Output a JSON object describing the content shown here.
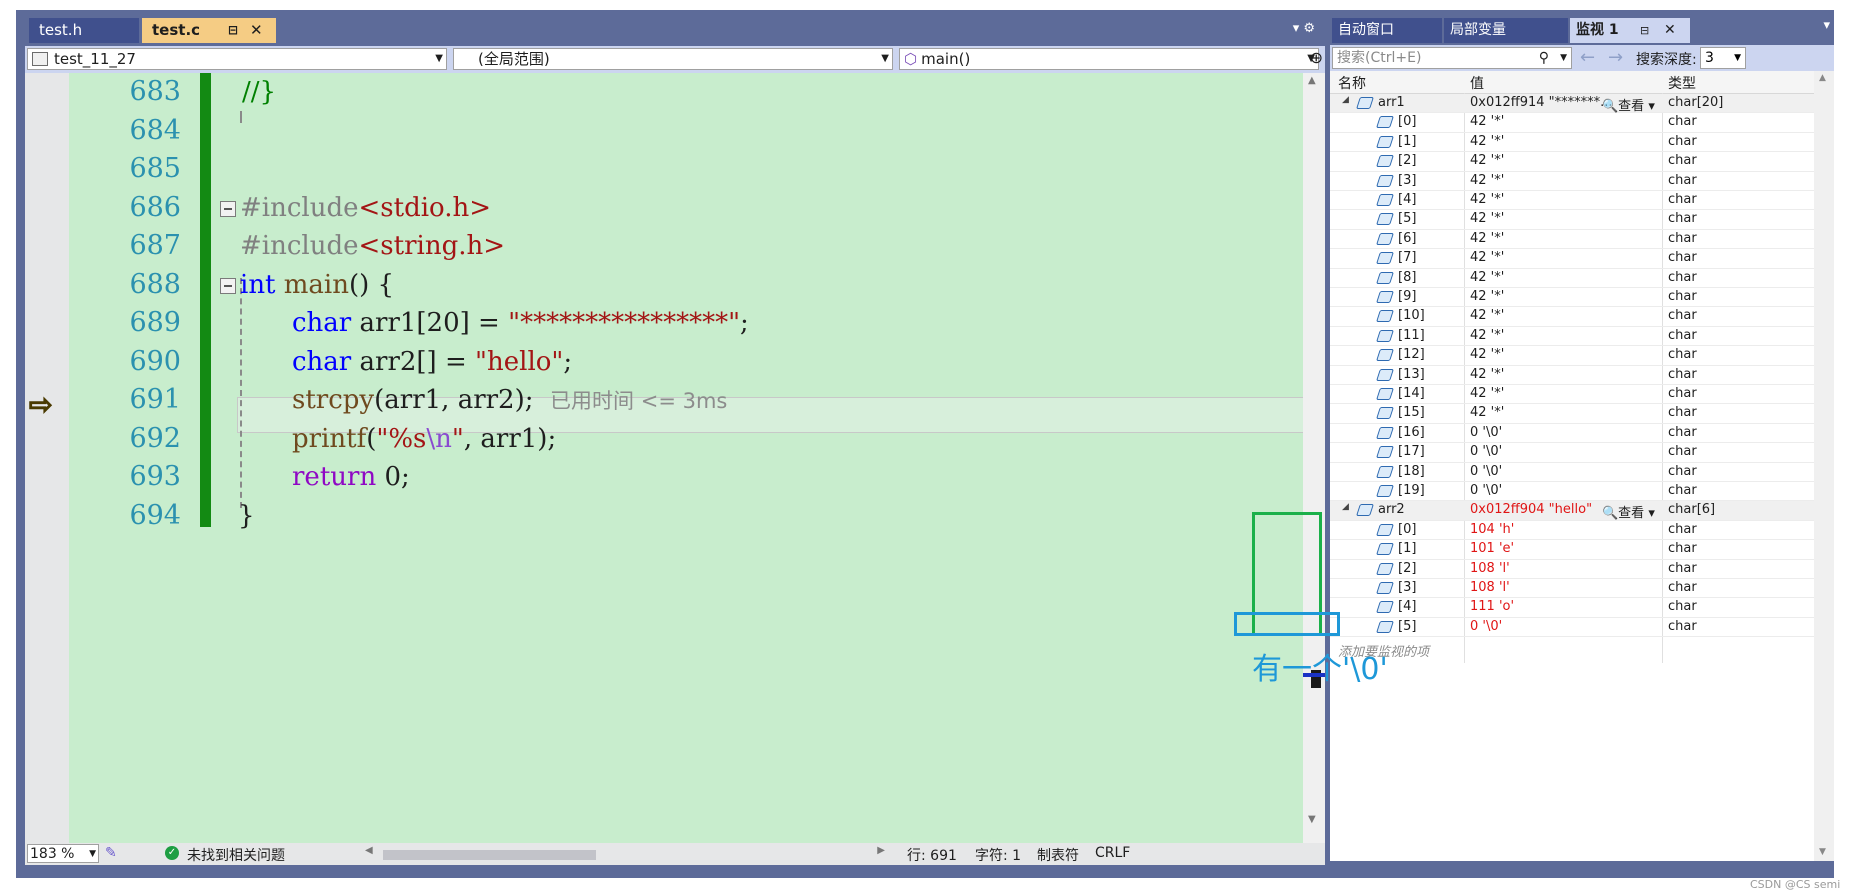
{
  "editor": {
    "tabs": [
      {
        "label": "test.h"
      },
      {
        "label": "test.c",
        "pin": "⊟",
        "close": "✕"
      }
    ],
    "tab_overflow": "▾ ⚙",
    "nav": {
      "project": "test_11_27",
      "scope": "(全局范围)",
      "function": "main()"
    },
    "lines": [
      683,
      684,
      685,
      686,
      687,
      688,
      689,
      690,
      691,
      692,
      693,
      694
    ],
    "code": {
      "l683": "//}",
      "l686_directive": "#include",
      "l686_header": "<stdio.h>",
      "l687_directive": "#include",
      "l687_header": "<string.h>",
      "l688_type": "int",
      "l688_func": "main",
      "l688_rest": "() {",
      "l689_type": "char",
      "l689_var": " arr1[20] = ",
      "l689_str": "\"****************\"",
      "l689_end": ";",
      "l690_type": "char",
      "l690_var": " arr2[] = ",
      "l690_str": "\"hello\"",
      "l690_end": ";",
      "l691_func": "strcpy",
      "l691_rest": "(arr1, arr2);",
      "l691_perf": "已用时间 <= 3ms",
      "l692_func": "printf",
      "l692_open": "(",
      "l692_str_a": "\"%s",
      "l692_esc": "\\n",
      "l692_str_b": "\"",
      "l692_rest": ", arr1);",
      "l693_kw": "return",
      "l693_rest": " 0;",
      "l694": "}"
    }
  },
  "status": {
    "zoom": "183 %",
    "issues": "未找到相关问题",
    "line": "行: 691",
    "char": "字符: 1",
    "tabs": "制表符",
    "eol": "CRLF"
  },
  "watch": {
    "tabs": {
      "auto": "自动窗口",
      "locals": "局部变量",
      "watch": "监视 1",
      "pin": "⊟",
      "close": "✕"
    },
    "overflow": "▾",
    "search_placeholder": "搜索(Ctrl+E)",
    "search_icon": "⚲",
    "back_arrow": "←",
    "forward_arrow": "→",
    "depth_label": "搜索深度:",
    "depth_value": "3",
    "columns": {
      "name": "名称",
      "value": "值",
      "type": "类型"
    },
    "arr1": {
      "name": "arr1",
      "value": "0x012ff914 \"*******...",
      "look": "🔍查看 ▾",
      "type": "char[20]"
    },
    "arr1_items": [
      {
        "name": "[0]",
        "value": "42 '*'",
        "type": "char"
      },
      {
        "name": "[1]",
        "value": "42 '*'",
        "type": "char"
      },
      {
        "name": "[2]",
        "value": "42 '*'",
        "type": "char"
      },
      {
        "name": "[3]",
        "value": "42 '*'",
        "type": "char"
      },
      {
        "name": "[4]",
        "value": "42 '*'",
        "type": "char"
      },
      {
        "name": "[5]",
        "value": "42 '*'",
        "type": "char"
      },
      {
        "name": "[6]",
        "value": "42 '*'",
        "type": "char"
      },
      {
        "name": "[7]",
        "value": "42 '*'",
        "type": "char"
      },
      {
        "name": "[8]",
        "value": "42 '*'",
        "type": "char"
      },
      {
        "name": "[9]",
        "value": "42 '*'",
        "type": "char"
      },
      {
        "name": "[10]",
        "value": "42 '*'",
        "type": "char"
      },
      {
        "name": "[11]",
        "value": "42 '*'",
        "type": "char"
      },
      {
        "name": "[12]",
        "value": "42 '*'",
        "type": "char"
      },
      {
        "name": "[13]",
        "value": "42 '*'",
        "type": "char"
      },
      {
        "name": "[14]",
        "value": "42 '*'",
        "type": "char"
      },
      {
        "name": "[15]",
        "value": "42 '*'",
        "type": "char"
      },
      {
        "name": "[16]",
        "value": "0 '\\0'",
        "type": "char"
      },
      {
        "name": "[17]",
        "value": "0 '\\0'",
        "type": "char"
      },
      {
        "name": "[18]",
        "value": "0 '\\0'",
        "type": "char"
      },
      {
        "name": "[19]",
        "value": "0 '\\0'",
        "type": "char"
      }
    ],
    "arr2": {
      "name": "arr2",
      "value": "0x012ff904 \"hello\"",
      "look": "🔍查看 ▾",
      "type": "char[6]"
    },
    "arr2_items": [
      {
        "name": "[0]",
        "value": "104 'h'",
        "type": "char"
      },
      {
        "name": "[1]",
        "value": "101 'e'",
        "type": "char"
      },
      {
        "name": "[2]",
        "value": "108 'l'",
        "type": "char"
      },
      {
        "name": "[3]",
        "value": "108 'l'",
        "type": "char"
      },
      {
        "name": "[4]",
        "value": "111 'o'",
        "type": "char"
      },
      {
        "name": "[5]",
        "value": "0 '\\0'",
        "type": "char"
      }
    ],
    "add_item": "添加要监视的项"
  },
  "annotation": "有一个'\\0'",
  "credit": "CSDN @CS semi",
  "colors": {
    "changed_value": "#e01515",
    "green_box": "#1bb04a",
    "blue_box": "#1e98d8",
    "change_bar": "#138a13"
  }
}
